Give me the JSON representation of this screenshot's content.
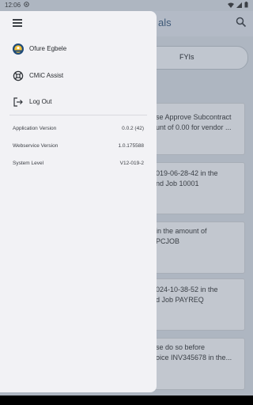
{
  "status": {
    "time": "12:06"
  },
  "appbar": {
    "title_fragment": "als"
  },
  "tabs": {
    "fyi_label": "FYIs"
  },
  "cards": [
    {
      "line1": "se Approve Subcontract",
      "line2": "unt of 0.00 for vendor ..."
    },
    {
      "line1": "019-06-28-42 in the",
      "line2": "nd Job 10001"
    },
    {
      "line1": " in the amount of",
      "line2": "PCJOB"
    },
    {
      "line1": "024-10-38-52 in the",
      "line2": "d Job PAYREQ"
    },
    {
      "line1": "se do so before",
      "line2": "oice INV345678 in the..."
    }
  ],
  "drawer": {
    "menu": [
      {
        "label": "Ofure Egbele",
        "icon": "avatar-icon"
      },
      {
        "label": "CMiC Assist",
        "icon": "lifebuoy-icon"
      },
      {
        "label": "Log Out",
        "icon": "logout-icon"
      }
    ],
    "info": [
      {
        "key": "Application Version",
        "value": "0.0.2 (42)"
      },
      {
        "key": "Webservice Version",
        "value": "1.0.175588"
      },
      {
        "key": "System Level",
        "value": "V12-019-2"
      }
    ]
  }
}
